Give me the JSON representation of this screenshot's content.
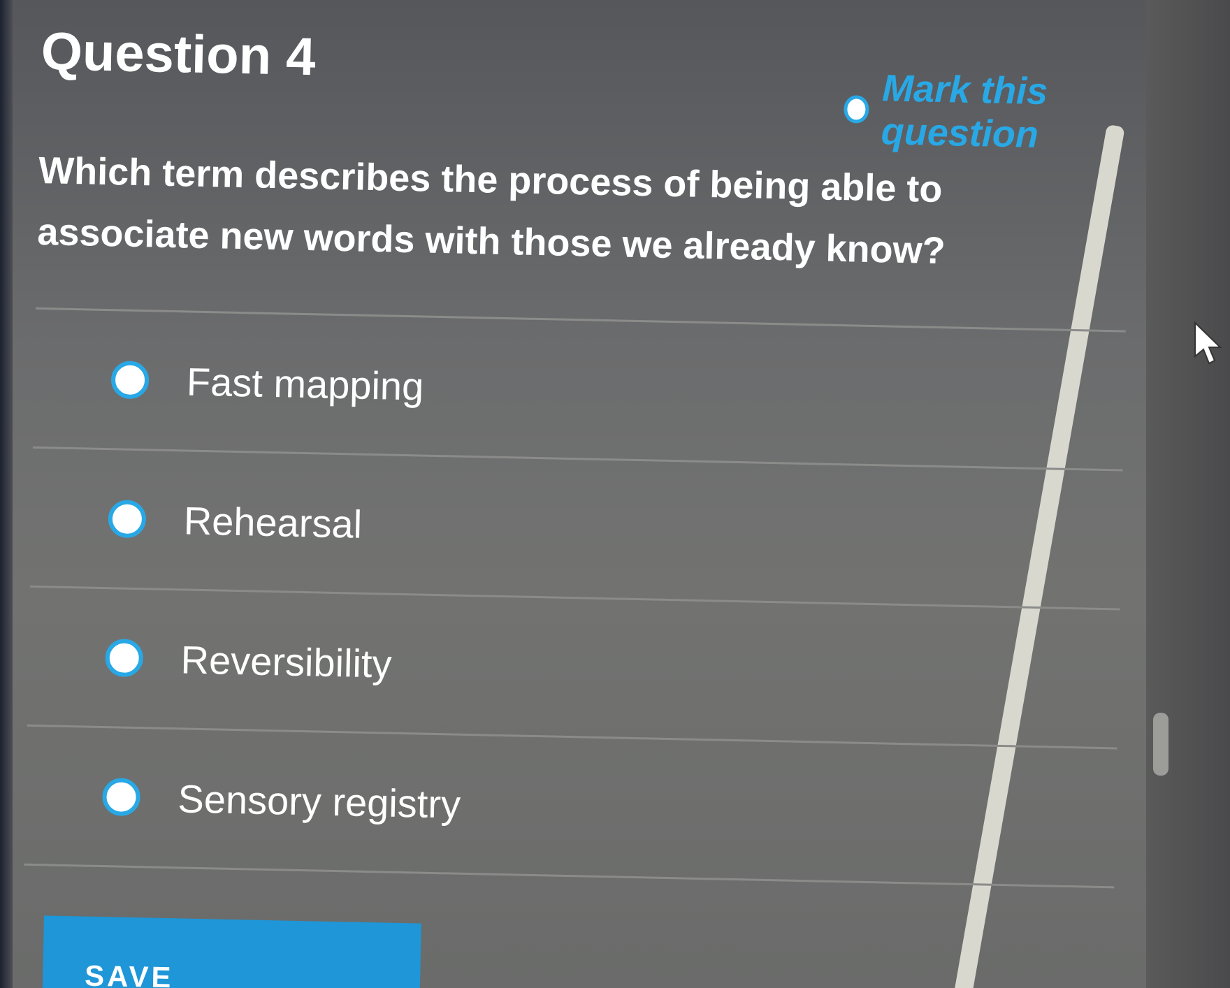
{
  "question": {
    "title": "Question 4",
    "mark_label": "Mark this question",
    "text": "Which term describes the process of being able to associate new words with those we already know?"
  },
  "options": [
    {
      "label": "Fast mapping"
    },
    {
      "label": "Rehearsal"
    },
    {
      "label": "Reversibility"
    },
    {
      "label": "Sensory registry"
    }
  ],
  "footer": {
    "save_label": "SAVE"
  },
  "colors": {
    "accent": "#29a8e6",
    "button": "#1e96d8",
    "text": "#ffffff",
    "background": "#6b6c6d"
  },
  "icons": {
    "cursor": "mouse-pointer-icon"
  }
}
